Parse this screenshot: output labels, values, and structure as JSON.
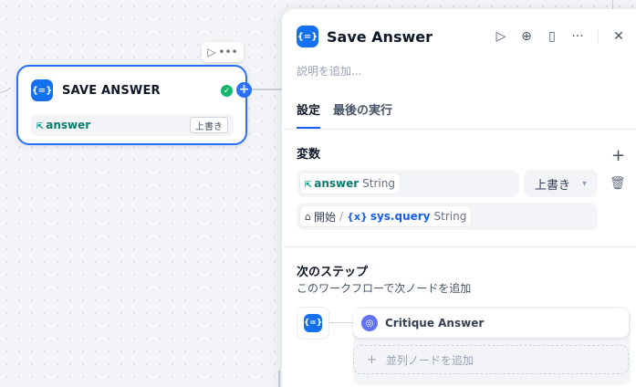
{
  "canvas": {
    "node": {
      "title": "SAVE ANSWER",
      "icon": "variable-assigner-icon",
      "icon_text": "{=}",
      "status": "success",
      "variable": {
        "name": "answer",
        "mode_badge": "上書き"
      }
    },
    "toolbar": {
      "run_icon": "play-icon",
      "more_icon": "more-horizontal-icon"
    }
  },
  "panel": {
    "title": "Save Answer",
    "icon_text": "{=}",
    "description_placeholder": "説明を追加...",
    "tabs": [
      {
        "label": "設定",
        "active": true
      },
      {
        "label": "最後の実行",
        "active": false
      }
    ],
    "variables": {
      "section_label": "変数",
      "assigned": {
        "name": "answer",
        "type": "String"
      },
      "mode": "上書き",
      "source": {
        "node": "開始",
        "separator": "/",
        "var_prefix": "{x}",
        "var": "sys.query",
        "type": "String"
      }
    },
    "next_step": {
      "section_label": "次のステップ",
      "description": "このワークフローで次ノードを追加",
      "next_node": {
        "name": "Critique Answer"
      },
      "add_parallel_label": "並列ノードを追加"
    }
  },
  "colors": {
    "accent": "#2970ff",
    "success": "#12b76a",
    "variable": "#0e9384"
  }
}
